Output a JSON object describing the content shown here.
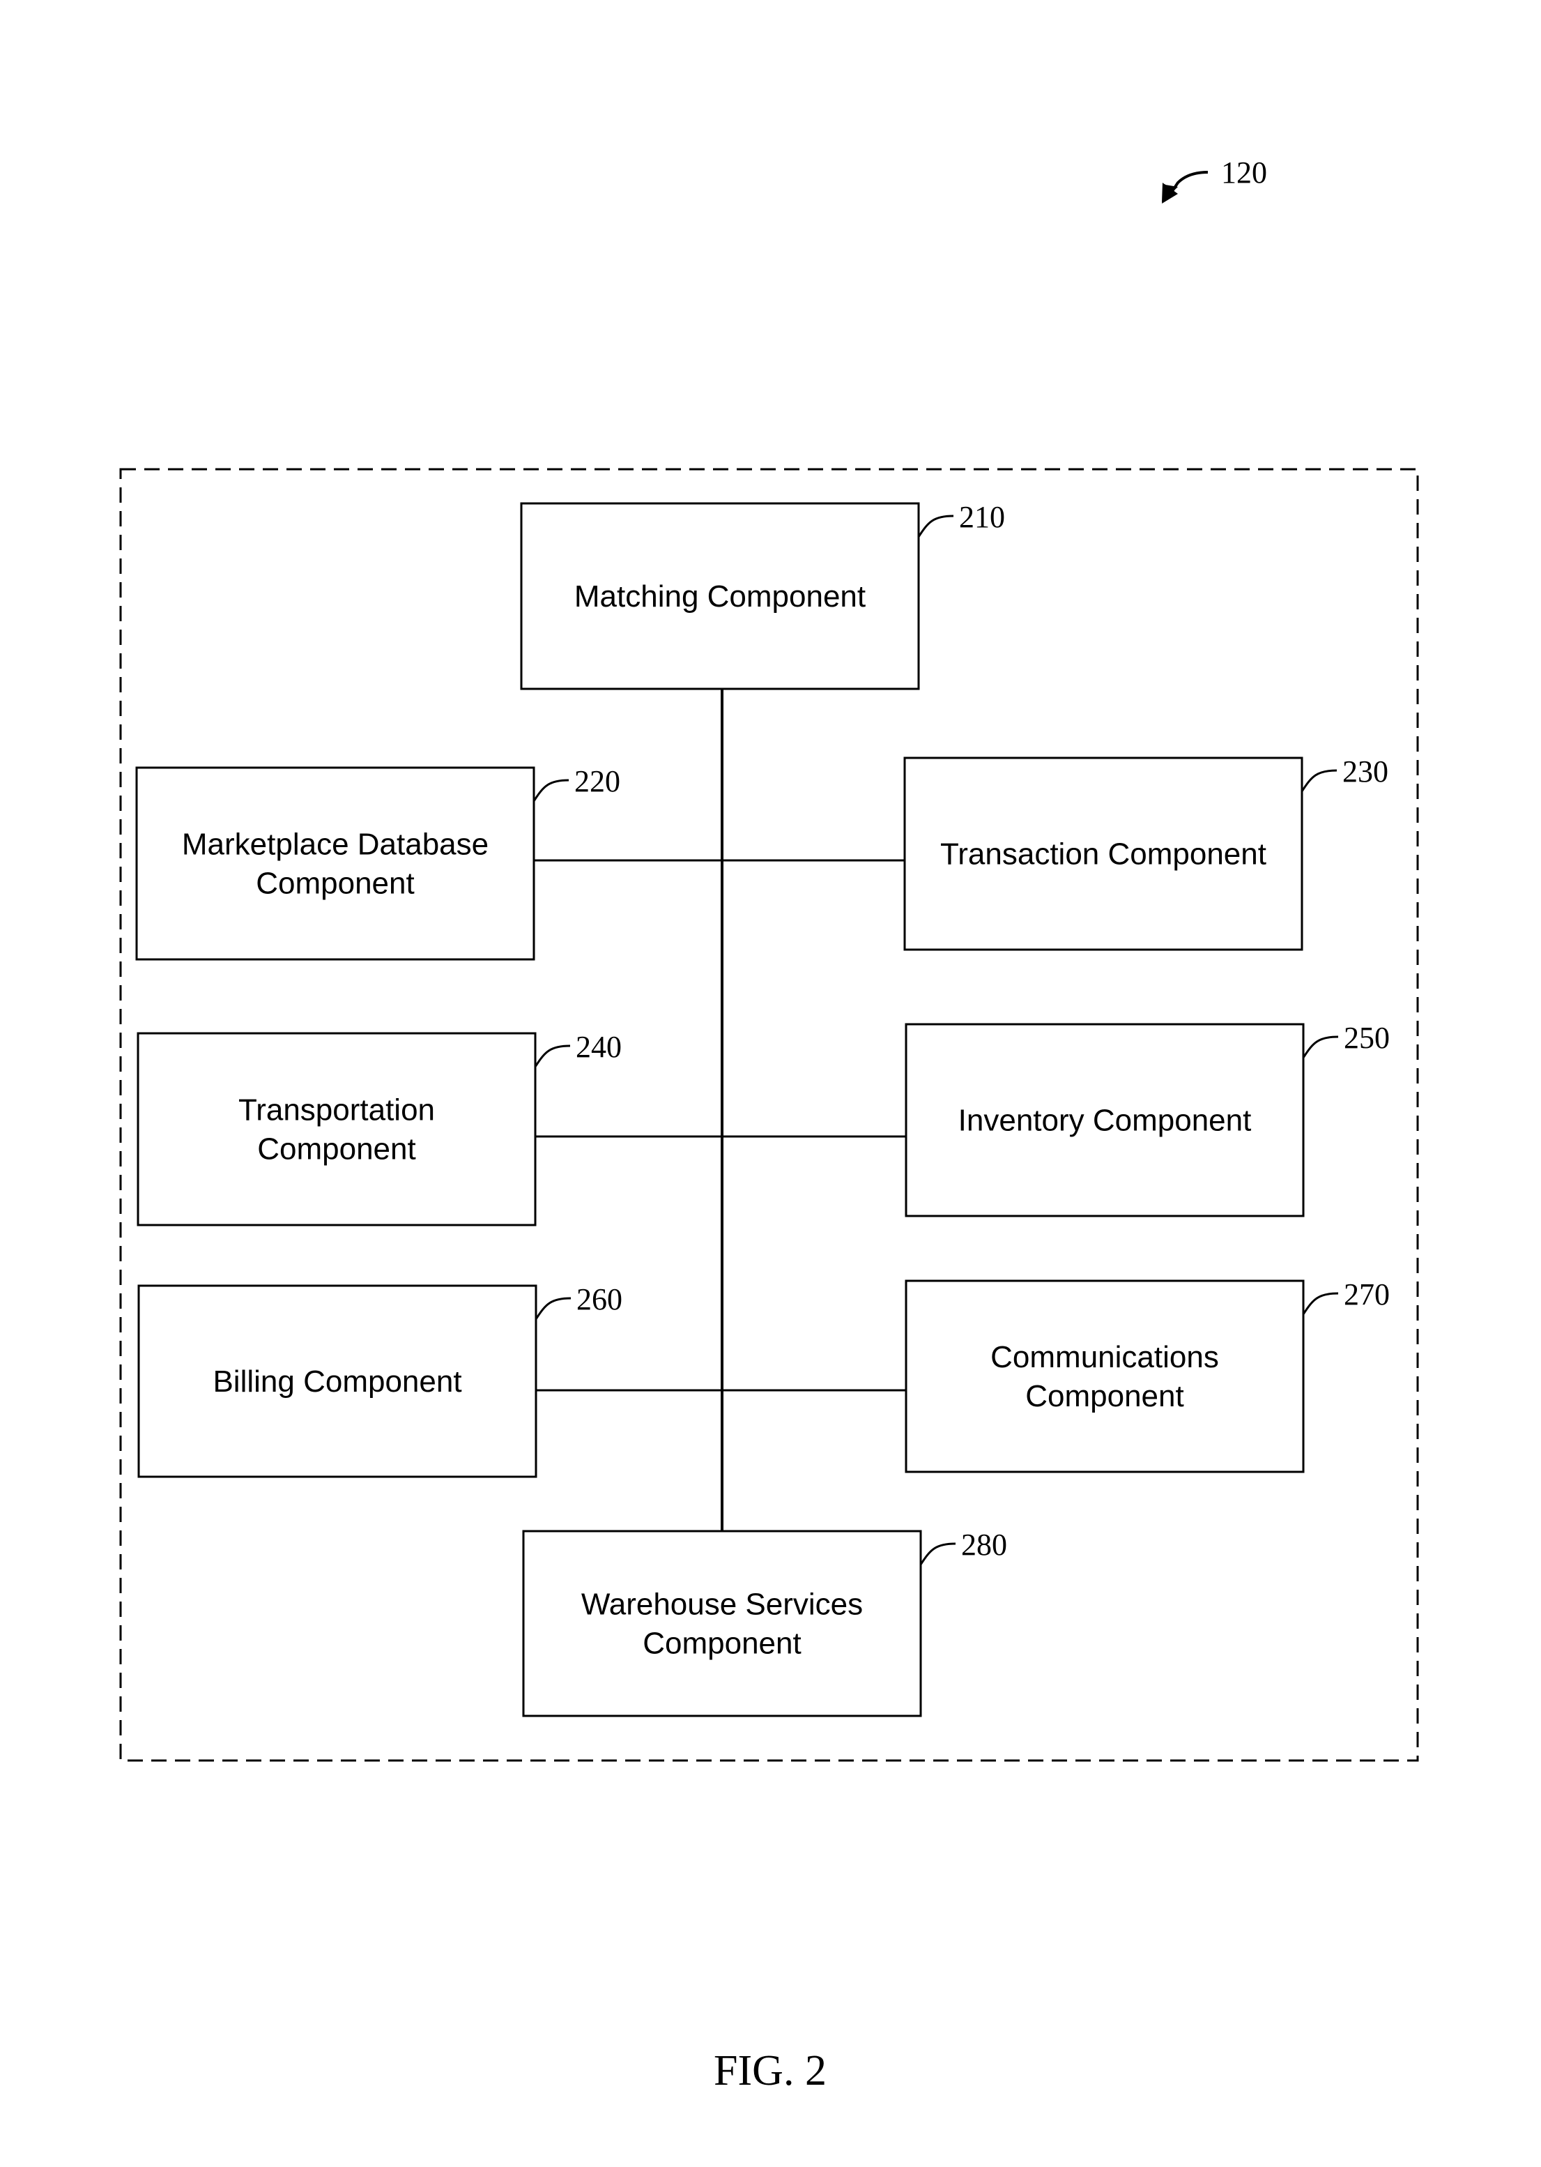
{
  "figure": {
    "caption": "FIG. 2",
    "system_ref": "120"
  },
  "components": [
    {
      "id": "matching",
      "ref": "210",
      "lines": [
        "Matching Component"
      ]
    },
    {
      "id": "marketplace-database",
      "ref": "220",
      "lines": [
        "Marketplace Database",
        "Component"
      ]
    },
    {
      "id": "transaction",
      "ref": "230",
      "lines": [
        "Transaction Component"
      ]
    },
    {
      "id": "transportation",
      "ref": "240",
      "lines": [
        "Transportation",
        "Component"
      ]
    },
    {
      "id": "inventory",
      "ref": "250",
      "lines": [
        "Inventory Component"
      ]
    },
    {
      "id": "billing",
      "ref": "260",
      "lines": [
        "Billing Component"
      ]
    },
    {
      "id": "communications",
      "ref": "270",
      "lines": [
        "Communications",
        "Component"
      ]
    },
    {
      "id": "warehouse-services",
      "ref": "280",
      "lines": [
        "Warehouse Services",
        "Component"
      ]
    }
  ],
  "connections": [
    [
      "matching",
      "warehouse-services"
    ],
    [
      "marketplace-database",
      "transaction"
    ],
    [
      "transportation",
      "inventory"
    ],
    [
      "billing",
      "communications"
    ]
  ]
}
